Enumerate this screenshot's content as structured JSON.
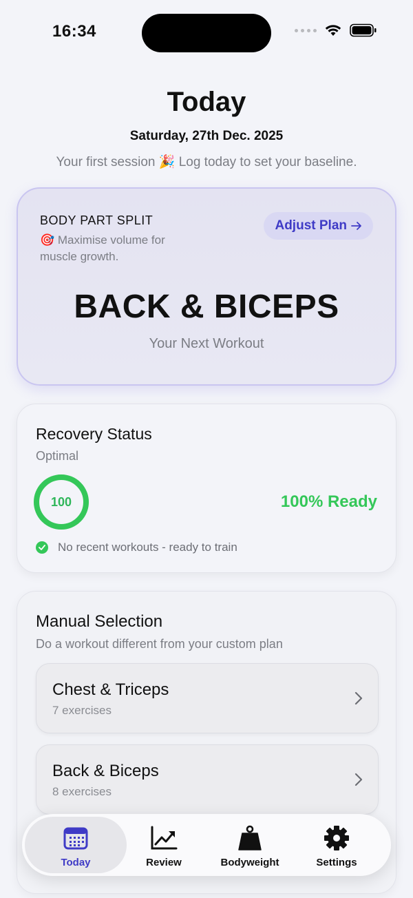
{
  "status_bar": {
    "time": "16:34"
  },
  "header": {
    "title": "Today",
    "date": "Saturday, 27th Dec. 2025",
    "subtitle": "Your first session 🎉 Log today to set your baseline."
  },
  "plan_card": {
    "plan_type": "BODY PART SPLIT",
    "description": "🎯 Maximise volume for muscle growth.",
    "adjust_label": "Adjust Plan",
    "workout_name": "BACK & BICEPS",
    "workout_caption": "Your Next Workout"
  },
  "recovery": {
    "title": "Recovery Status",
    "state": "Optimal",
    "score": "100",
    "score_fraction": 1.0,
    "ready_text": "100% Ready",
    "note": "No recent workouts - ready to train",
    "accent_color": "#34c759"
  },
  "manual": {
    "title": "Manual Selection",
    "subtitle": "Do a workout different from your custom plan",
    "workouts": [
      {
        "name": "Chest & Triceps",
        "count": "7 exercises"
      },
      {
        "name": "Back & Biceps",
        "count": "8 exercises"
      }
    ]
  },
  "tabs": [
    {
      "label": "Today",
      "icon": "calendar-icon",
      "active": true
    },
    {
      "label": "Review",
      "icon": "chart-trend-icon",
      "active": false
    },
    {
      "label": "Bodyweight",
      "icon": "weight-icon",
      "active": false
    },
    {
      "label": "Settings",
      "icon": "gear-icon",
      "active": false
    }
  ],
  "colors": {
    "accent": "#3f3bc6",
    "success": "#34c759"
  }
}
